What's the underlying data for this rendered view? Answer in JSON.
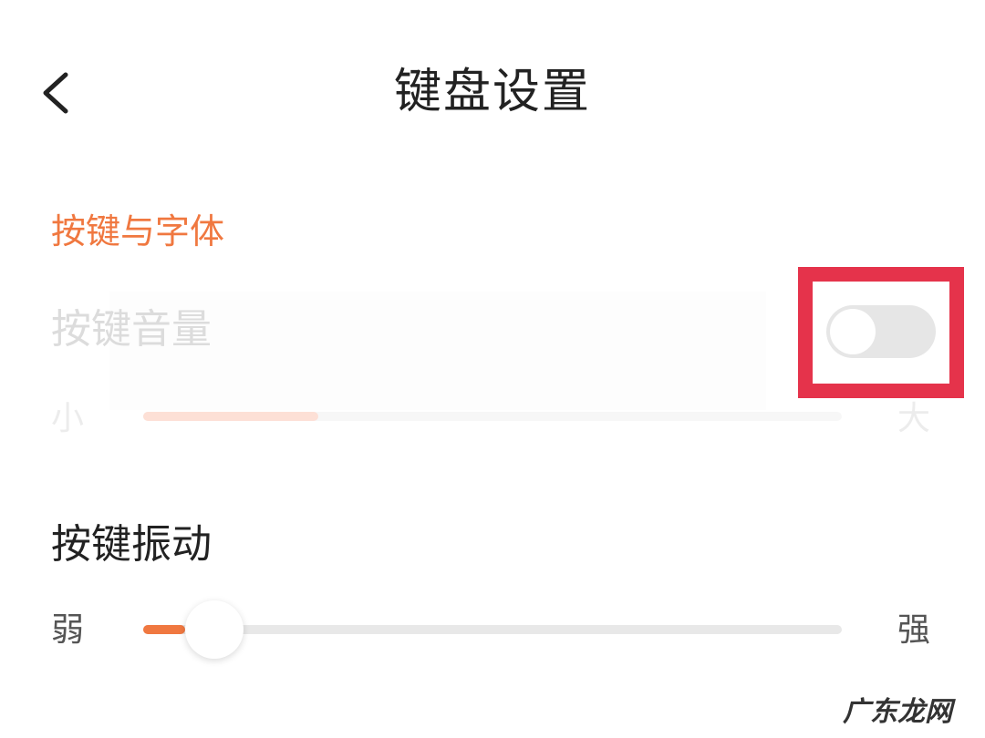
{
  "header": {
    "title": "键盘设置",
    "back_icon": "chevron-left-icon"
  },
  "section": {
    "title": "按键与字体"
  },
  "key_volume": {
    "label": "按键音量",
    "toggle_on": false,
    "min_label": "小",
    "max_label": "大",
    "level": 0.25
  },
  "key_vibration": {
    "label": "按键振动",
    "min_label": "弱",
    "max_label": "强",
    "level": 0.06
  },
  "colors": {
    "accent": "#f07840",
    "highlight": "#e5334b",
    "track": "#e8e8e8"
  },
  "watermark": "广东龙网"
}
